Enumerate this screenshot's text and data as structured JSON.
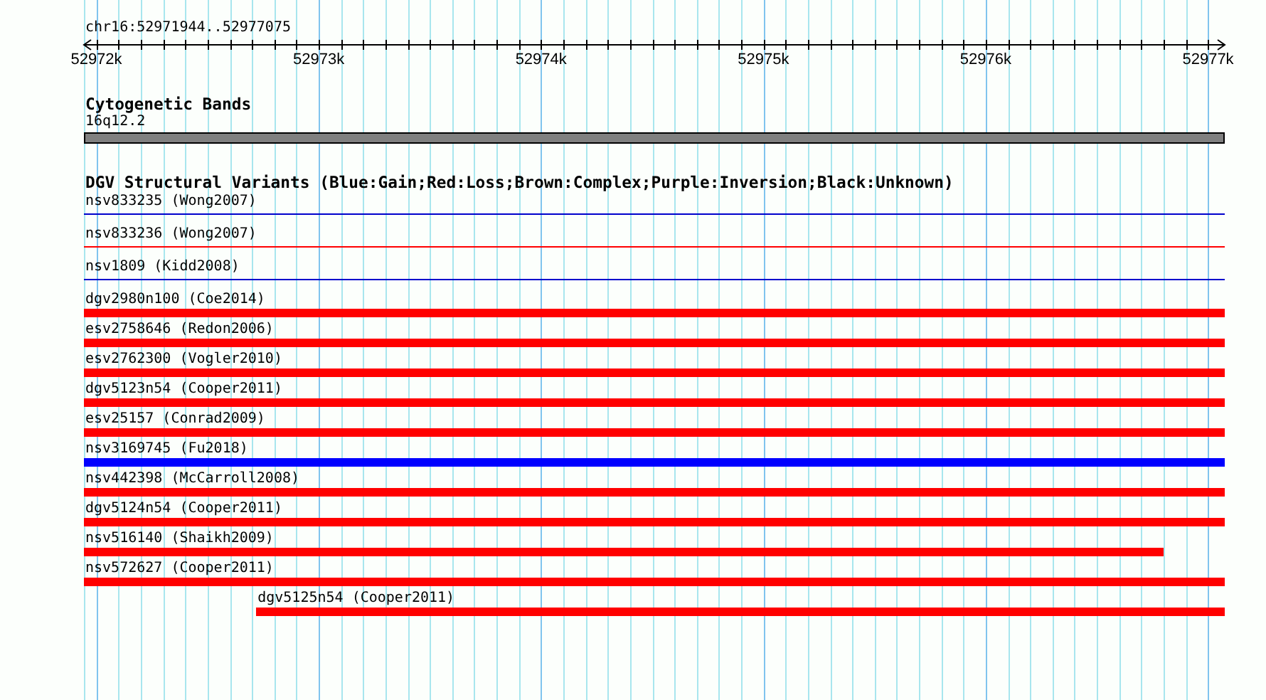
{
  "ruler": {
    "title": "chr16:52971944..52977075",
    "ticks": [
      "52972k",
      "52973k",
      "52974k",
      "52975k",
      "52976k",
      "52977k"
    ]
  },
  "cytogenetic_track": {
    "title": "Cytogenetic Bands",
    "band_label": "16q12.2"
  },
  "variant_track": {
    "title": "DGV Structural Variants (Blue:Gain;Red:Loss;Brown:Complex;Purple:Inversion;Black:Unknown)",
    "features": [
      {
        "label": "nsv833235 (Wong2007)",
        "kind": "line",
        "color": "#0000cc"
      },
      {
        "label": "nsv833236 (Wong2007)",
        "kind": "line",
        "color": "#ff0000"
      },
      {
        "label": "nsv1809 (Kidd2008)",
        "kind": "line",
        "color": "#0000cc"
      },
      {
        "label": "dgv2980n100 (Coe2014)",
        "kind": "bar",
        "color": "#ff0000"
      },
      {
        "label": "esv2758646 (Redon2006)",
        "kind": "bar",
        "color": "#ff0000"
      },
      {
        "label": "esv2762300 (Vogler2010)",
        "kind": "bar",
        "color": "#ff0000"
      },
      {
        "label": "dgv5123n54 (Cooper2011)",
        "kind": "bar",
        "color": "#ff0000"
      },
      {
        "label": "esv25157 (Conrad2009)",
        "kind": "bar",
        "color": "#ff0000"
      },
      {
        "label": "nsv3169745 (Fu2018)",
        "kind": "bar",
        "color": "#0000ff"
      },
      {
        "label": "nsv442398 (McCarroll2008)",
        "kind": "bar",
        "color": "#ff0000"
      },
      {
        "label": "dgv5124n54 (Cooper2011)",
        "kind": "bar",
        "color": "#ff0000"
      },
      {
        "label": "nsv516140 (Shaikh2009)",
        "kind": "short_bar",
        "color": "#ff0000"
      },
      {
        "label": "nsv572627 (Cooper2011)",
        "kind": "bar",
        "color": "#ff0000"
      },
      {
        "label": "dgv5125n54 (Cooper2011)",
        "kind": "late_bar",
        "color": "#ff0000"
      }
    ]
  }
}
